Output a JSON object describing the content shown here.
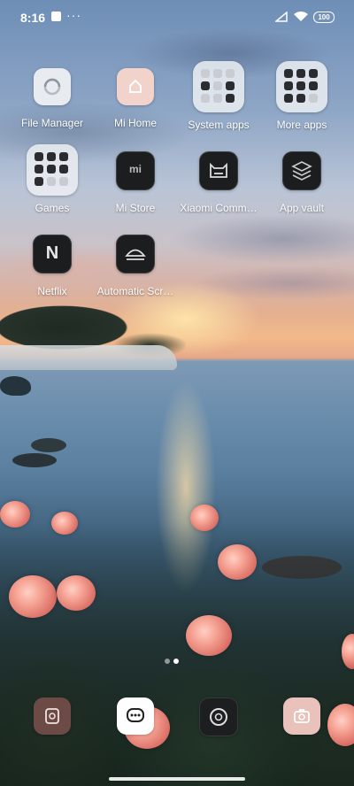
{
  "status_bar": {
    "time": "8:16",
    "notification_dots": "···",
    "battery": "100"
  },
  "apps": [
    {
      "name": "File Manager",
      "icon": "file-manager-icon"
    },
    {
      "name": "Mi Home",
      "icon": "mi-home-icon"
    },
    {
      "name": "System apps",
      "icon": "folder-icon"
    },
    {
      "name": "More apps",
      "icon": "folder-icon"
    },
    {
      "name": "Games",
      "icon": "folder-icon"
    },
    {
      "name": "Mi Store",
      "icon": "mi-store-icon"
    },
    {
      "name": "Xiaomi Comm…",
      "icon": "xiaomi-community-icon"
    },
    {
      "name": "App vault",
      "icon": "app-vault-icon"
    },
    {
      "name": "Netflix",
      "icon": "netflix-icon"
    },
    {
      "name": "Automatic Scr…",
      "icon": "automatic-screen-icon"
    }
  ],
  "mi_store_logo_text": "mi",
  "netflix_logo_text": "N",
  "dock": [
    {
      "icon": "gallery-icon"
    },
    {
      "icon": "messages-icon"
    },
    {
      "icon": "browser-icon"
    },
    {
      "icon": "camera-icon"
    }
  ],
  "colors": {
    "icon_light": "#e8ebf0",
    "icon_dark": "#1c1d1f",
    "mi_home_pink": "#f1d3cc",
    "folder_bg": "#eceef2"
  }
}
